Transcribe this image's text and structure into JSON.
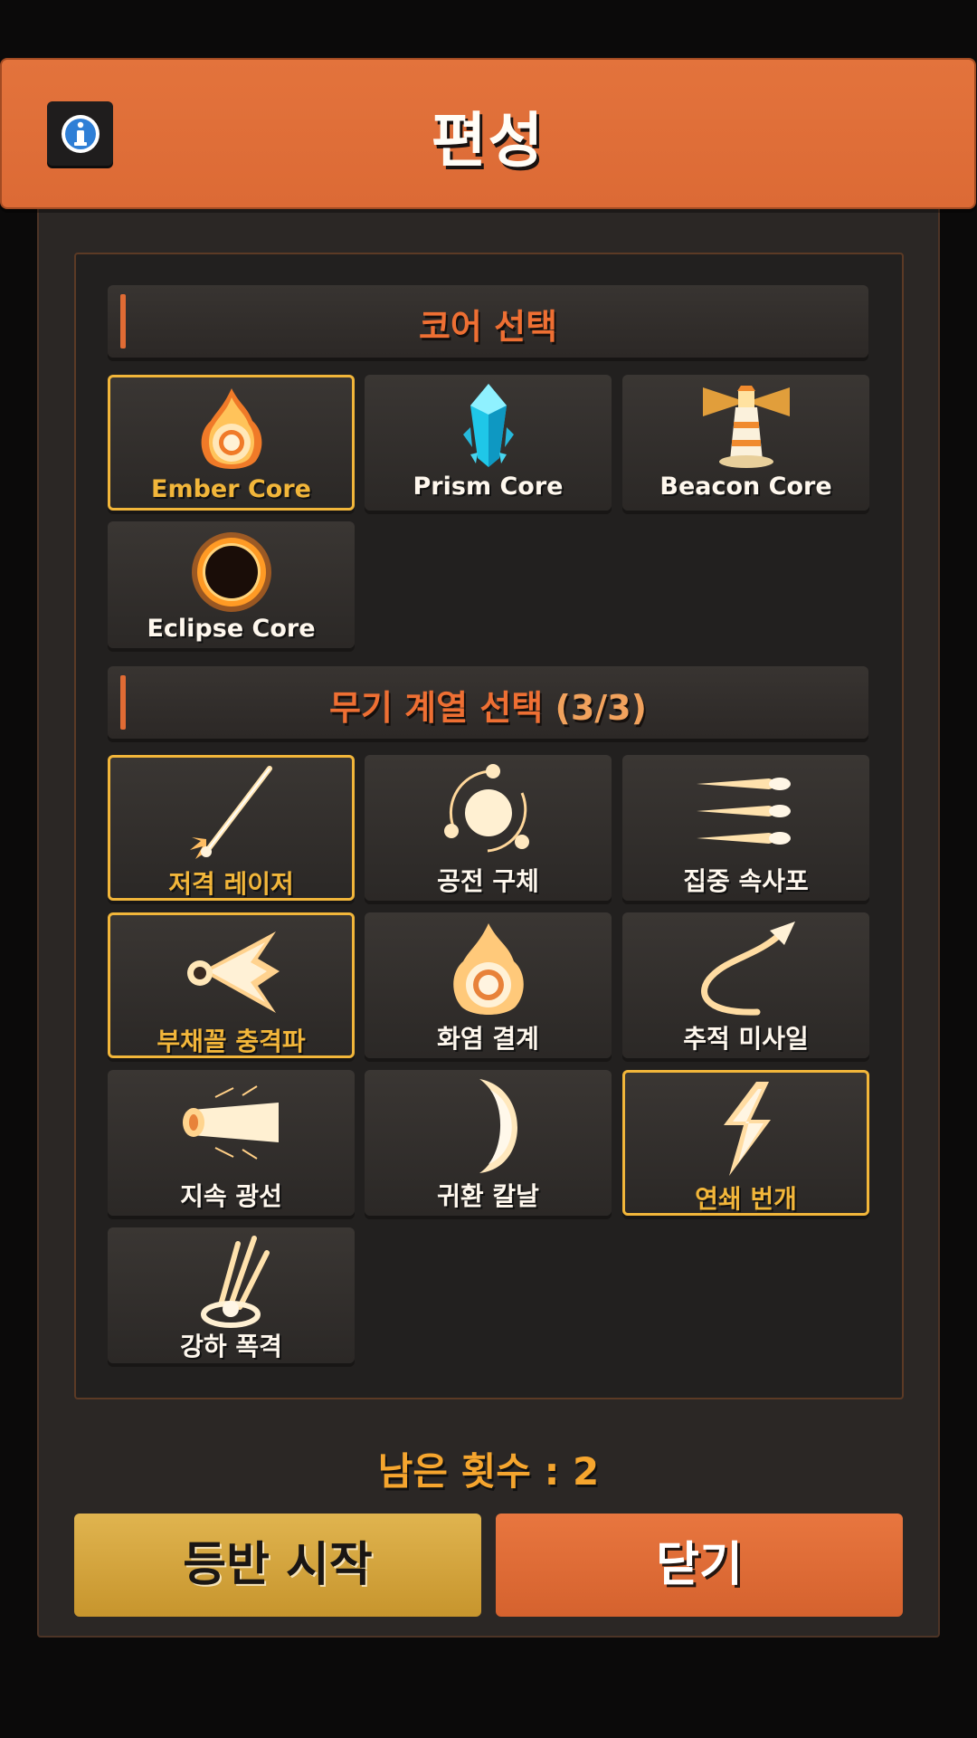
{
  "header": {
    "title": "편성"
  },
  "core_section": {
    "title": "코어 선택",
    "items": [
      {
        "label": "Ember Core",
        "icon": "fire-ring-icon",
        "selected": true
      },
      {
        "label": "Prism Core",
        "icon": "crystal-icon",
        "selected": false
      },
      {
        "label": "Beacon Core",
        "icon": "lighthouse-icon",
        "selected": false
      },
      {
        "label": "Eclipse Core",
        "icon": "eclipse-icon",
        "selected": false
      }
    ]
  },
  "weapon_section": {
    "title": "무기 계열 선택",
    "count": "(3/3)",
    "items": [
      {
        "label": "저격 레이저",
        "icon": "sniper-laser-icon",
        "selected": true
      },
      {
        "label": "공전 구체",
        "icon": "orbit-sphere-icon",
        "selected": false
      },
      {
        "label": "집중 속사포",
        "icon": "rapid-fire-icon",
        "selected": false
      },
      {
        "label": "부채꼴 충격파",
        "icon": "fan-shockwave-icon",
        "selected": true
      },
      {
        "label": "화염 결계",
        "icon": "flame-barrier-icon",
        "selected": false
      },
      {
        "label": "추적 미사일",
        "icon": "homing-missile-icon",
        "selected": false
      },
      {
        "label": "지속 광선",
        "icon": "beam-icon",
        "selected": false
      },
      {
        "label": "귀환 칼날",
        "icon": "crescent-blade-icon",
        "selected": false
      },
      {
        "label": "연쇄 번개",
        "icon": "chain-lightning-icon",
        "selected": true
      },
      {
        "label": "강하 폭격",
        "icon": "bombardment-icon",
        "selected": false
      }
    ]
  },
  "footer": {
    "remaining": "남은 횟수 : 2",
    "start_label": "등반 시작",
    "close_label": "닫기"
  },
  "colors": {
    "accent": "#e06b34",
    "selected": "#f2b63a"
  }
}
